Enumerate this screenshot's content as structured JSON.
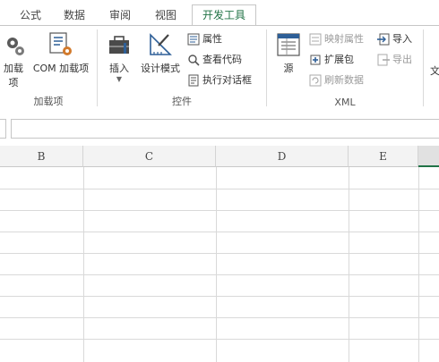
{
  "tabs": [
    {
      "label": "公式"
    },
    {
      "label": "数据"
    },
    {
      "label": "审阅"
    },
    {
      "label": "视图"
    },
    {
      "label": "开发工具",
      "active": true
    }
  ],
  "ribbon": {
    "addins": {
      "addins_label": "加载项",
      "com_addins_label": "COM 加载项",
      "group_label": "加载项"
    },
    "controls": {
      "insert_label": "插入",
      "design_mode_label": "设计模式",
      "properties_label": "属性",
      "view_code_label": "查看代码",
      "run_dialog_label": "执行对话框",
      "group_label": "控件"
    },
    "xml": {
      "source_label": "源",
      "map_properties_label": "映射属性",
      "expansion_packs_label": "扩展包",
      "refresh_data_label": "刷新数据",
      "import_label": "导入",
      "export_label": "导出",
      "group_label": "XML"
    },
    "partial_next_label": "文"
  },
  "columns": [
    "B",
    "C",
    "D",
    "E"
  ],
  "colors": {
    "accent": "#217346",
    "icon_blue": "#2e5f97",
    "icon_orange": "#d27a2c"
  }
}
